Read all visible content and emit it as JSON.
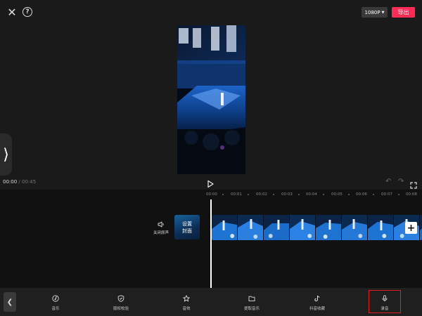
{
  "header": {
    "close_icon": "close-icon",
    "help_icon": "help-icon",
    "resolution": "1080P",
    "export_label": "导出"
  },
  "player": {
    "current_time": "00:00",
    "separator": "/",
    "total_time": "00:45"
  },
  "timeline": {
    "ticks": [
      "00:00",
      "00:01",
      "00:02",
      "00:03",
      "00:04",
      "00:05",
      "00:06",
      "00:07",
      "00:08"
    ],
    "mute_label": "关闭原声",
    "cover_line1": "设置",
    "cover_line2": "封面",
    "add_icon": "plus-icon"
  },
  "toolbar": {
    "items": [
      {
        "label": "音乐",
        "icon": "music-icon"
      },
      {
        "label": "版权校验",
        "icon": "copyright-check-icon"
      },
      {
        "label": "音效",
        "icon": "sound-effect-icon"
      },
      {
        "label": "提取音乐",
        "icon": "extract-music-icon"
      },
      {
        "label": "抖音收藏",
        "icon": "douyin-favorite-icon"
      },
      {
        "label": "录音",
        "icon": "microphone-icon"
      }
    ],
    "highlighted": "录音"
  },
  "colors": {
    "accent": "#fe2c55",
    "highlight_box": "#e0201f",
    "background": "#1a1a1a"
  }
}
